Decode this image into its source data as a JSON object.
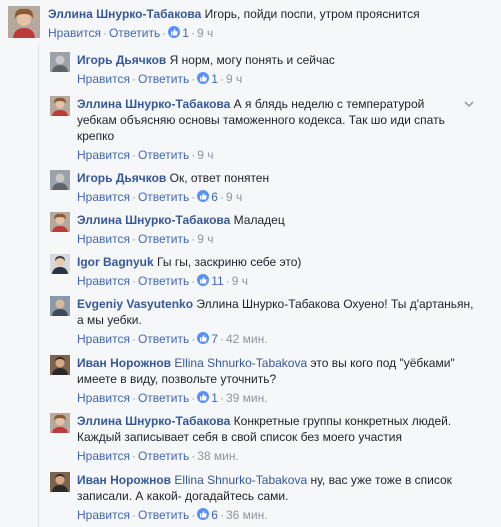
{
  "actions": {
    "like": "Нравится",
    "reply": "Ответить",
    "sep": "·"
  },
  "comments": [
    {
      "author": "Эллина Шнурко-Табакова",
      "mention": "",
      "text": "Игорь, пойди поспи, утром прояснится",
      "reactions": "1",
      "time": "9 ч"
    },
    {
      "author": "Игорь Дьячков",
      "mention": "",
      "text": "Я норм, могу понять и сейчас",
      "reactions": "1",
      "time": "9 ч"
    },
    {
      "author": "Эллина Шнурко-Табакова",
      "mention": "",
      "text": "А я блядь неделю с температурой уебкам объясняю основы таможенного кодекса. Так шо иди спать крепко",
      "reactions": "",
      "time": "9 ч"
    },
    {
      "author": "Игорь Дьячков",
      "mention": "",
      "text": "Ок, ответ понятен",
      "reactions": "6",
      "time": "9 ч"
    },
    {
      "author": "Эллина Шнурко-Табакова",
      "mention": "",
      "text": "Маладец",
      "reactions": "",
      "time": "9 ч"
    },
    {
      "author": "Igor Bagnyuk",
      "mention": "",
      "text": "Гы гы, заскриню себе это)",
      "reactions": "11",
      "time": "9 ч"
    },
    {
      "author": "Evgeniy Vasyutenko",
      "mention": "",
      "text": "Эллина Шнурко-Табакова Охуено! Ты д'артаньян, а мы уебки.",
      "reactions": "7",
      "time": "42 мин."
    },
    {
      "author": "Иван Норожнов",
      "mention": "Ellina Shnurko-Tabakova",
      "text": "это вы кого под \"уёбками\" имеете в виду, позвольте уточнить?",
      "reactions": "1",
      "time": "39 мин."
    },
    {
      "author": "Эллина Шнурко-Табакова",
      "mention": "",
      "text": "Конкретные группы конкретных людей. Каждый записывает себя в свой список без моего участия",
      "reactions": "",
      "time": "38 мин."
    },
    {
      "author": "Иван Норожнов",
      "mention": "Ellina Shnurko-Tabakova",
      "text": "ну, вас уже тоже в список записали. А какой- догадайтесь сами.",
      "reactions": "6",
      "time": "36 мин."
    }
  ],
  "icons": {
    "reaction": "thumbs-up-icon",
    "more": "chevron-down-icon"
  },
  "colors": {
    "author": "#365899",
    "link": "#4267b2",
    "meta": "#90949c",
    "reaction": "#5890ff"
  }
}
